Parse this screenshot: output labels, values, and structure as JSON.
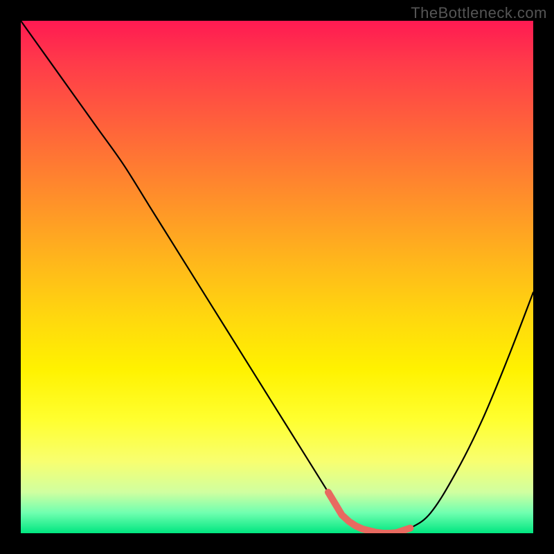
{
  "watermark": "TheBottleneck.com",
  "colors": {
    "frame": "#000000",
    "gradient_top": "#ff1a52",
    "gradient_bottom": "#00e680",
    "curve": "#000000",
    "marker": "#e86a60"
  },
  "chart_data": {
    "type": "line",
    "title": "",
    "xlabel": "",
    "ylabel": "",
    "xlim": [
      0,
      100
    ],
    "ylim": [
      0,
      100
    ],
    "grid": false,
    "legend": null,
    "x": [
      0,
      5,
      10,
      15,
      20,
      25,
      30,
      35,
      40,
      45,
      50,
      55,
      60,
      63,
      66,
      70,
      73,
      76,
      80,
      85,
      90,
      95,
      100
    ],
    "values": [
      100,
      93,
      86,
      79,
      72,
      64,
      56,
      48,
      40,
      32,
      24,
      16,
      8,
      3,
      1,
      0,
      0,
      1,
      4,
      12,
      22,
      34,
      47
    ],
    "marker_range_x": [
      60,
      76
    ],
    "annotations": []
  }
}
